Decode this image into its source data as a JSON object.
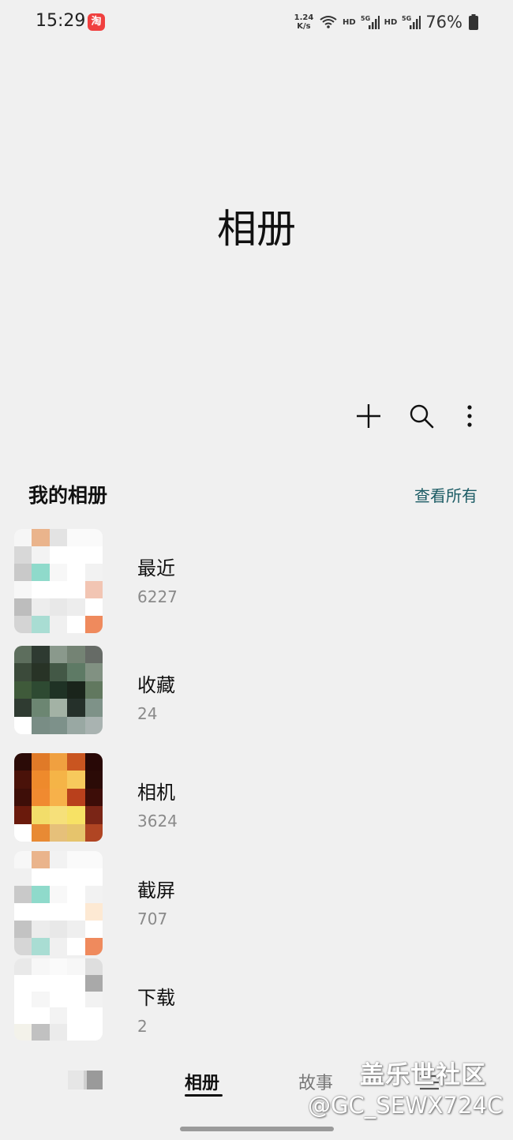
{
  "status_bar": {
    "time": "15:29",
    "app_badge": "淘",
    "network_speed_value": "1.24",
    "network_speed_unit": "K/s",
    "hd_1": "HD",
    "hd_2": "HD",
    "signal_1": "5G",
    "signal_2": "5G",
    "battery": "76%"
  },
  "header": {
    "title": "相册"
  },
  "toolbar": {
    "icons": [
      "plus-icon",
      "search-icon",
      "more-vertical-icon"
    ]
  },
  "section": {
    "title": "我的相册",
    "view_all": "查看所有"
  },
  "albums": [
    {
      "name": "最近",
      "count": "6227"
    },
    {
      "name": "收藏",
      "count": "24"
    },
    {
      "name": "相机",
      "count": "3624"
    },
    {
      "name": "截屏",
      "count": "707"
    },
    {
      "name": "下载",
      "count": "2"
    }
  ],
  "bottom_nav": {
    "tabs": [
      {
        "label": "相册",
        "active": true
      },
      {
        "label": "故事",
        "active": false
      }
    ]
  },
  "watermark": {
    "line1": "盖乐世社区",
    "line2": "@GC_SEWX724C"
  },
  "colors": {
    "background": "#f0f0f0",
    "accent_link": "#1b5b64",
    "count_gray": "#8a8a8a"
  }
}
